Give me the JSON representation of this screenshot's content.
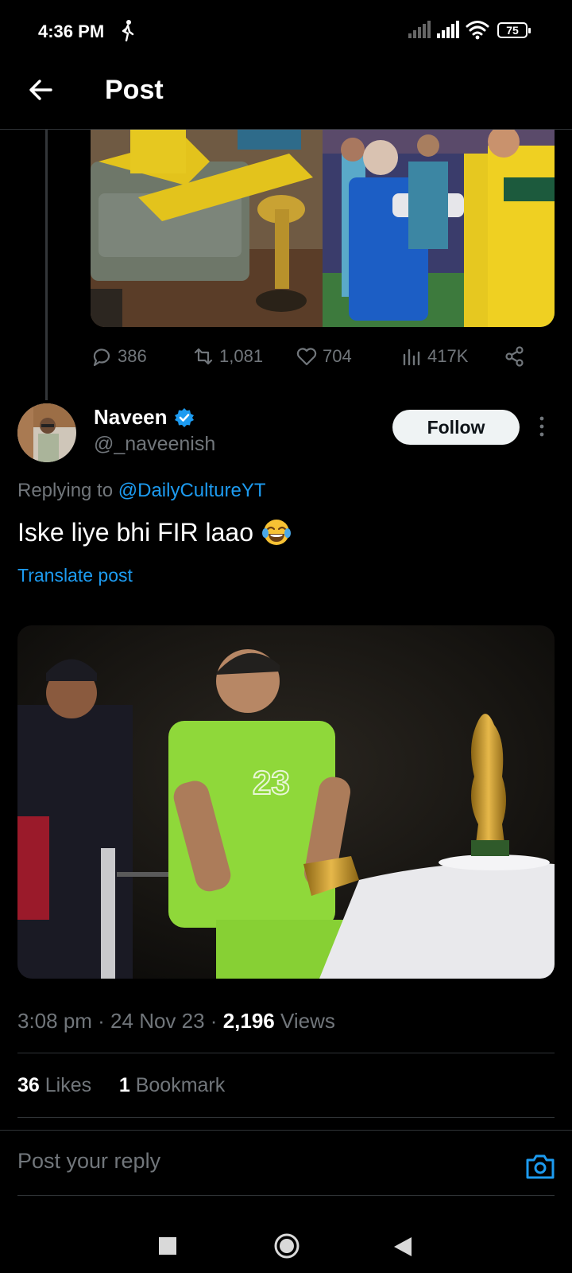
{
  "status_bar": {
    "time": "4:36 PM",
    "battery": "75"
  },
  "header": {
    "title": "Post"
  },
  "prev_post_actions": {
    "replies": "386",
    "reposts": "1,081",
    "likes": "704",
    "views": "417K"
  },
  "post": {
    "author_name": "Naveen",
    "author_handle": "@_naveenish",
    "follow_label": "Follow",
    "replying_prefix": "Replying to ",
    "replying_mention": "@DailyCultureYT",
    "text": "Iske liye bhi FIR laao",
    "emoji": "😂",
    "translate_label": "Translate post",
    "jersey_number": "23",
    "meta_time": "3:08 pm · 24 Nov 23 · ",
    "meta_views_count": "2,196",
    "meta_views_label": " Views",
    "likes_count": "36",
    "likes_label": " Likes",
    "bookmarks_count": "1",
    "bookmarks_label": " Bookmark"
  },
  "reply_bar": {
    "placeholder": "Post your reply"
  },
  "colors": {
    "accent": "#1d9bf0",
    "background": "#000000",
    "muted": "#71767b"
  }
}
